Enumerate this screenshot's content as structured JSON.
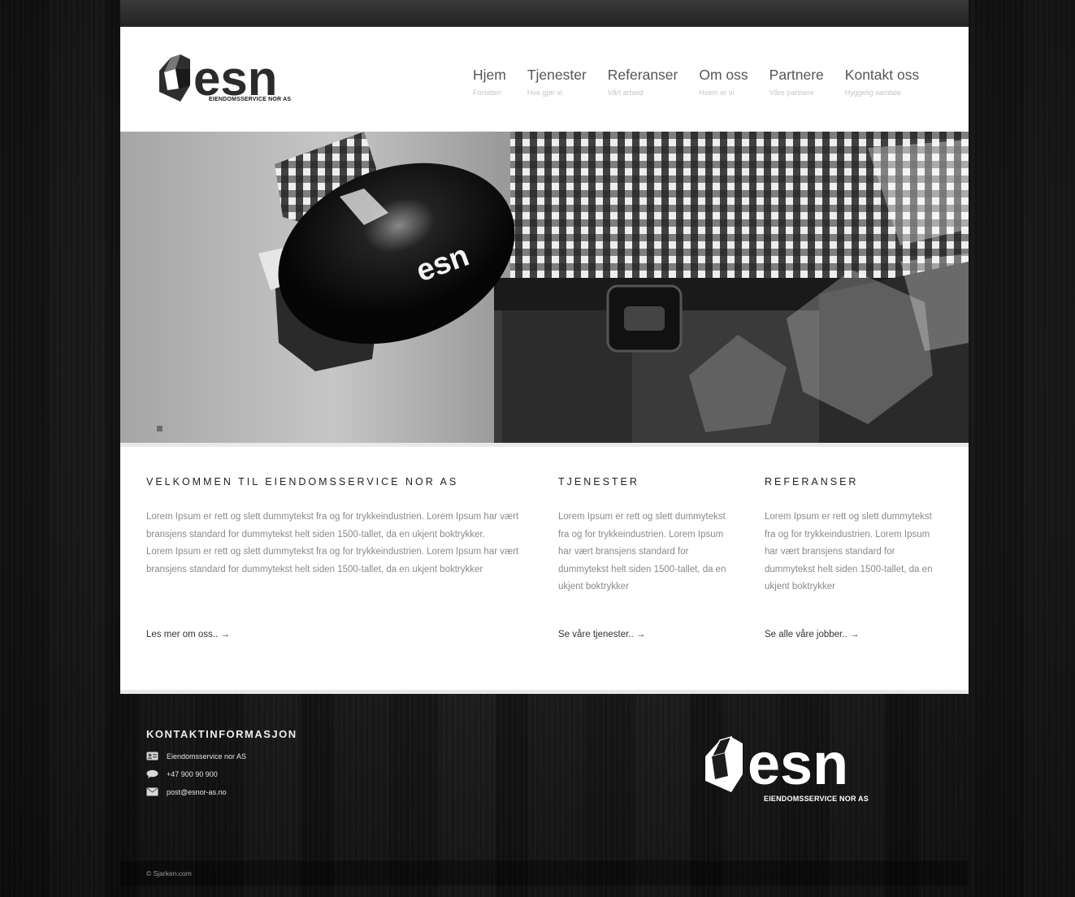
{
  "brand": {
    "logo_text": "esn",
    "logo_subtitle": "EIENDOMSSERVICE NOR AS"
  },
  "nav": [
    {
      "label": "Hjem",
      "sub": "Forsiden"
    },
    {
      "label": "Tjenester",
      "sub": "Hva gjør vi"
    },
    {
      "label": "Referanser",
      "sub": "Vårt arbeid"
    },
    {
      "label": "Om oss",
      "sub": "Hvem er vi"
    },
    {
      "label": "Partnere",
      "sub": "Våre partnere"
    },
    {
      "label": "Kontakt oss",
      "sub": "Hyggelig samtale"
    }
  ],
  "hero": {
    "helmet_logo": "esn",
    "slides_total": 2,
    "active_slide": 2
  },
  "sections": {
    "welcome": {
      "heading": "VELKOMMEN TIL EIENDOMSSERVICE NOR AS",
      "para1": "Lorem Ipsum er rett og slett dummytekst fra og for trykkeindustrien. Lorem Ipsum har vært bransjens standard for dummytekst helt siden 1500-tallet, da en ukjent boktrykker.",
      "para2": "Lorem Ipsum er rett og slett dummytekst fra og for trykkeindustrien. Lorem Ipsum har vært bransjens standard for dummytekst helt siden 1500-tallet, da en ukjent boktrykker",
      "link": "Les mer om oss.. →"
    },
    "services": {
      "heading": "TJENESTER",
      "para": "Lorem Ipsum er rett og slett dummytekst fra og for trykkeindustrien. Lorem Ipsum har vært bransjens standard for dummytekst helt siden 1500-tallet, da en ukjent boktrykker",
      "link": "Se våre tjenester.. →"
    },
    "references": {
      "heading": "REFERANSER",
      "para": "Lorem Ipsum er rett og slett dummytekst fra og for trykkeindustrien. Lorem Ipsum har vært bransjens standard for dummytekst helt siden 1500-tallet, da en ukjent boktrykker",
      "link": "Se alle våre jobber.. →"
    }
  },
  "footer": {
    "heading": "KONTAKTINFORMASJON",
    "company": "Eiendomsservice nor AS",
    "phone": "+47 900 90 900",
    "email": "post@esnor-as.no",
    "logo_text": "esn",
    "logo_subtitle": "EIENDOMSSERVICE NOR AS",
    "copyright": "© Sjarken.com"
  },
  "icons": {
    "company": "id-card-icon",
    "phone": "chat-bubble-icon",
    "email": "envelope-icon"
  },
  "colors": {
    "page_bg": "#1c1c1c",
    "panel_bg": "#ffffff",
    "nav_text": "#555555",
    "nav_sub": "#c4c4c4",
    "body_text": "#8a8a8a",
    "heading_text": "#222222"
  }
}
